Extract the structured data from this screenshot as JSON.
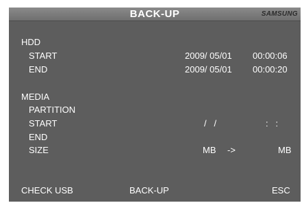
{
  "header": {
    "title": "BACK-UP",
    "brand": "SAMSUNG"
  },
  "hdd": {
    "label": "HDD",
    "start": {
      "label": "START",
      "date": "2009/ 05/01",
      "time": "00:00:06"
    },
    "end": {
      "label": "END",
      "date": "2009/ 05/01",
      "time": "00:00:20"
    }
  },
  "media": {
    "label": "MEDIA",
    "partition": {
      "label": "PARTITION"
    },
    "start": {
      "label": "START",
      "date": "/   /",
      "time": ":   :"
    },
    "end": {
      "label": "END"
    },
    "size": {
      "label": "SIZE",
      "from": "MB",
      "arrow": "->",
      "to": "MB"
    }
  },
  "footer": {
    "check_usb": "CHECK USB",
    "backup": "BACK-UP",
    "esc": "ESC"
  },
  "colors": {
    "background": "#5d5d5d",
    "title_bar": "#7a7a7a",
    "text": "#ffffff"
  }
}
